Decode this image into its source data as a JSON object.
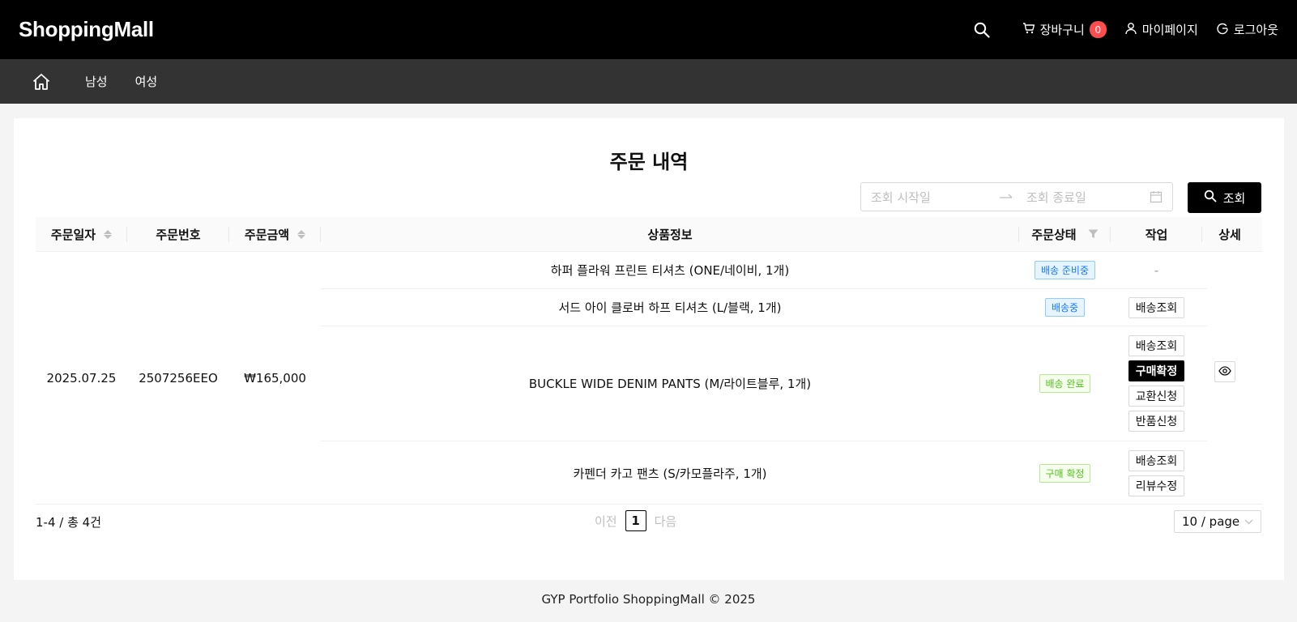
{
  "header": {
    "logo": "ShoppingMall",
    "cart_label": "장바구니",
    "cart_count": "0",
    "mypage_label": "마이페이지",
    "logout_label": "로그아웃"
  },
  "nav": {
    "items": [
      "남성",
      "여성"
    ]
  },
  "main": {
    "title": "주문 내역",
    "date_start_placeholder": "조회 시작일",
    "date_end_placeholder": "조회 종료일",
    "query_button": "조회"
  },
  "table": {
    "columns": [
      "주문일자",
      "주문번호",
      "주문금액",
      "상품정보",
      "주문상태",
      "작업",
      "상세"
    ],
    "order": {
      "date": "2025.07.25",
      "number": "2507256EEO",
      "amount": "₩165,000"
    },
    "rows": [
      {
        "product": "하퍼 플라워 프린트 티셔츠 (ONE/네이비, 1개)",
        "status": "배송 준비중",
        "status_color": "#1677ff",
        "actions": [],
        "no_action": "-"
      },
      {
        "product": "서드 아이 클로버 하프 티셔츠 (L/블랙, 1개)",
        "status": "배송중",
        "status_color": "#1677ff",
        "actions": [
          "배송조회"
        ]
      },
      {
        "product": "BUCKLE WIDE DENIM PANTS (M/라이트블루, 1개)",
        "status": "배송 완료",
        "status_color": "#52c41a",
        "actions": [
          "배송조회",
          "구매확정",
          "교환신청",
          "반품신청"
        ]
      },
      {
        "product": "카펜더 카고 팬츠 (S/카모플라주, 1개)",
        "status": "구매 확정",
        "status_color": "#52c41a",
        "actions": [
          "배송조회",
          "리뷰수정"
        ]
      }
    ]
  },
  "pagination": {
    "summary": "1-4 / 총 4건",
    "prev": "이전",
    "current": "1",
    "next": "다음",
    "page_size": "10 / page"
  },
  "footer": {
    "text": "GYP Portfolio ShoppingMall © 2025"
  }
}
